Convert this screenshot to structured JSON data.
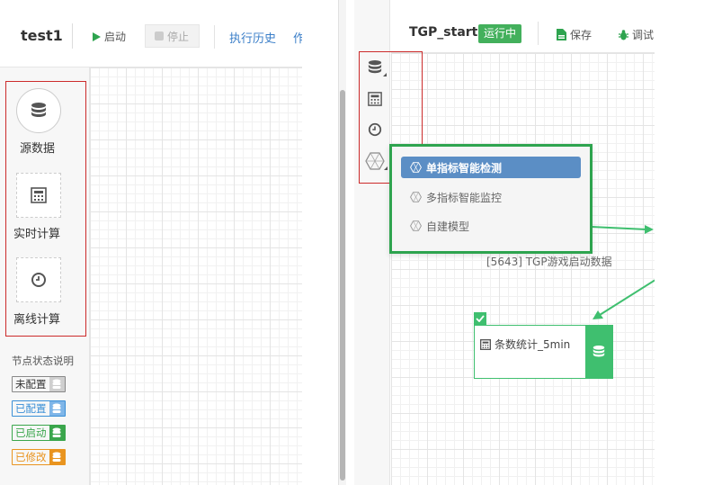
{
  "left_panel": {
    "title": "test1",
    "toolbar": {
      "start_label": "启动",
      "stop_label": "停止",
      "history_label": "执行历史",
      "more_label": "作"
    },
    "palette": [
      {
        "label": "源数据"
      },
      {
        "label": "实时计算"
      },
      {
        "label": "离线计算"
      }
    ],
    "legend": {
      "title": "节点状态说明",
      "items": [
        {
          "label": "未配置",
          "color": "#888888"
        },
        {
          "label": "已配置",
          "color": "#3a8fd6"
        },
        {
          "label": "已启动",
          "color": "#3aa64c"
        },
        {
          "label": "已修改",
          "color": "#e9941f"
        }
      ]
    }
  },
  "right_panel": {
    "title": "TGP_start",
    "status_badge": "运行中",
    "toolbar": {
      "save_label": "保存",
      "debug_label": "调试"
    },
    "dropdown_menu": {
      "items": [
        {
          "label": "单指标智能检测",
          "active": true
        },
        {
          "label": "多指标智能监控",
          "active": false
        },
        {
          "label": "自建模型",
          "active": false
        }
      ]
    },
    "node_caption": "[5643] TGP游戏启动数据",
    "node": {
      "label": "条数统计_5min"
    }
  },
  "colors": {
    "green": "#3fbf6f",
    "blue_active": "#5b8ec5",
    "red_outline": "#cc2b2b",
    "highlight_green": "#2ea44f"
  }
}
